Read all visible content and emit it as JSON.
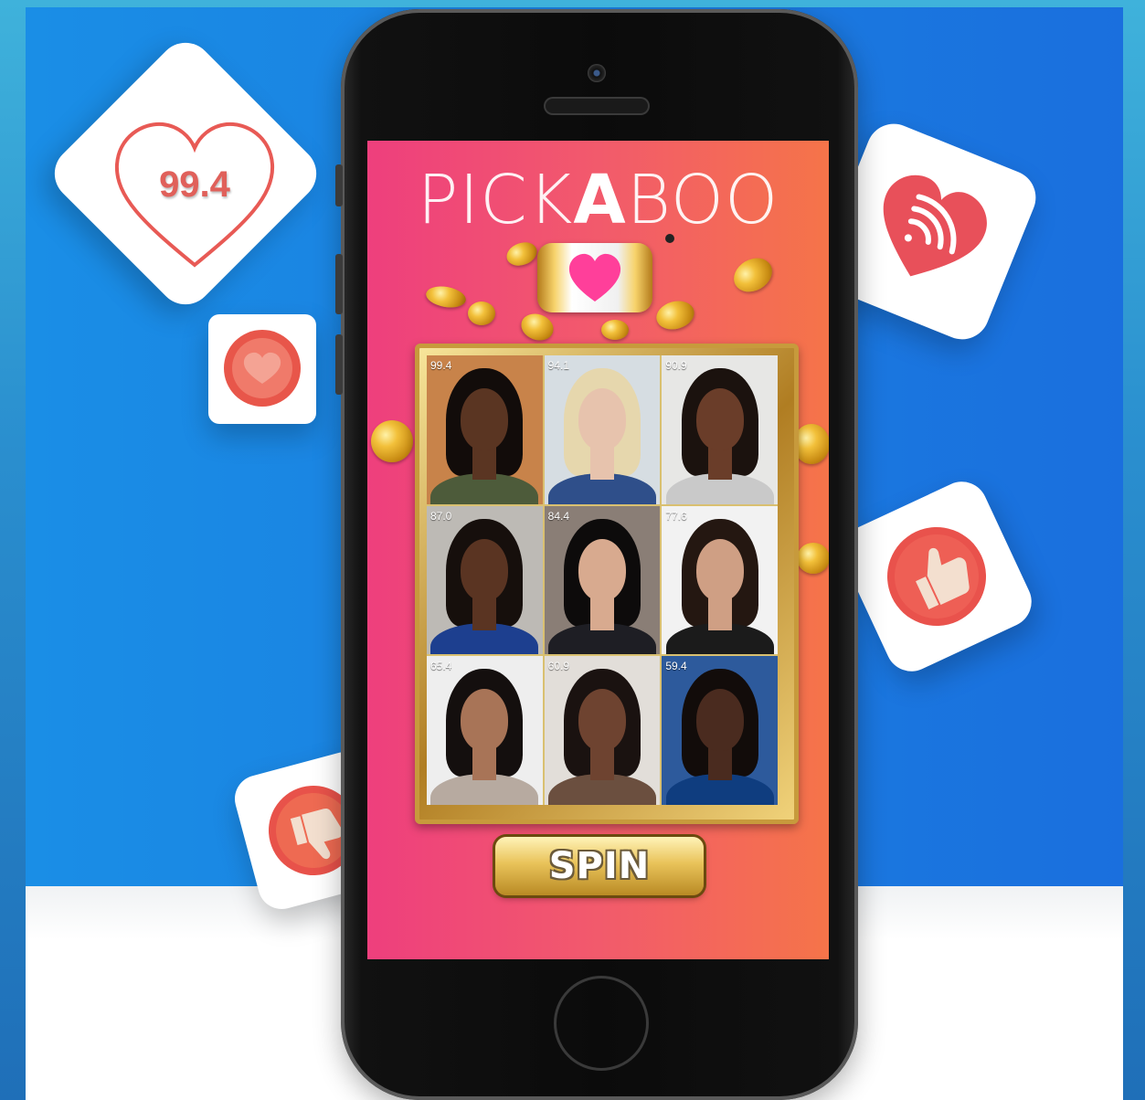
{
  "app": {
    "name_prefix": "PICK",
    "name_accent": "A",
    "name_suffix": "BOO"
  },
  "badges": {
    "top_score": "99.4"
  },
  "grid": {
    "cells": [
      {
        "score": "99.4",
        "skin": "#5a3522",
        "hair": "#120c0a",
        "bg": "#c8834a",
        "top": "#4d5b3a"
      },
      {
        "score": "94.1",
        "skin": "#e7c3ad",
        "hair": "#e6d7ad",
        "bg": "#d6dde2",
        "top": "#2f4f8a"
      },
      {
        "score": "90.9",
        "skin": "#6a3d29",
        "hair": "#1b120e",
        "bg": "#e7e7e5",
        "top": "#c9c9c9"
      },
      {
        "score": "87.0",
        "skin": "#5a3422",
        "hair": "#160f0c",
        "bg": "#bdbab5",
        "top": "#1d3f8f"
      },
      {
        "score": "84.4",
        "skin": "#d8aa8f",
        "hair": "#0d0b0b",
        "bg": "#8a7e76",
        "top": "#1e1e24"
      },
      {
        "score": "77.6",
        "skin": "#cf9f84",
        "hair": "#241711",
        "bg": "#f2f2f2",
        "top": "#1b1b1b"
      },
      {
        "score": "65.4",
        "skin": "#a87457",
        "hair": "#140f0e",
        "bg": "#eeeeee",
        "top": "#b7aaa0"
      },
      {
        "score": "60.9",
        "skin": "#6e4330",
        "hair": "#1a1210",
        "bg": "#e2ded9",
        "top": "#6b4f3f"
      },
      {
        "score": "59.4",
        "skin": "#4a2b1f",
        "hair": "#120c0a",
        "bg": "#2d5a9c",
        "top": "#0f3d7f"
      }
    ]
  },
  "actions": {
    "spin_label": "SPIN"
  },
  "icons": [
    "heart-score-icon",
    "heart-coin-icon",
    "heart-wifi-icon",
    "thumbs-up-icon",
    "thumbs-down-icon"
  ]
}
